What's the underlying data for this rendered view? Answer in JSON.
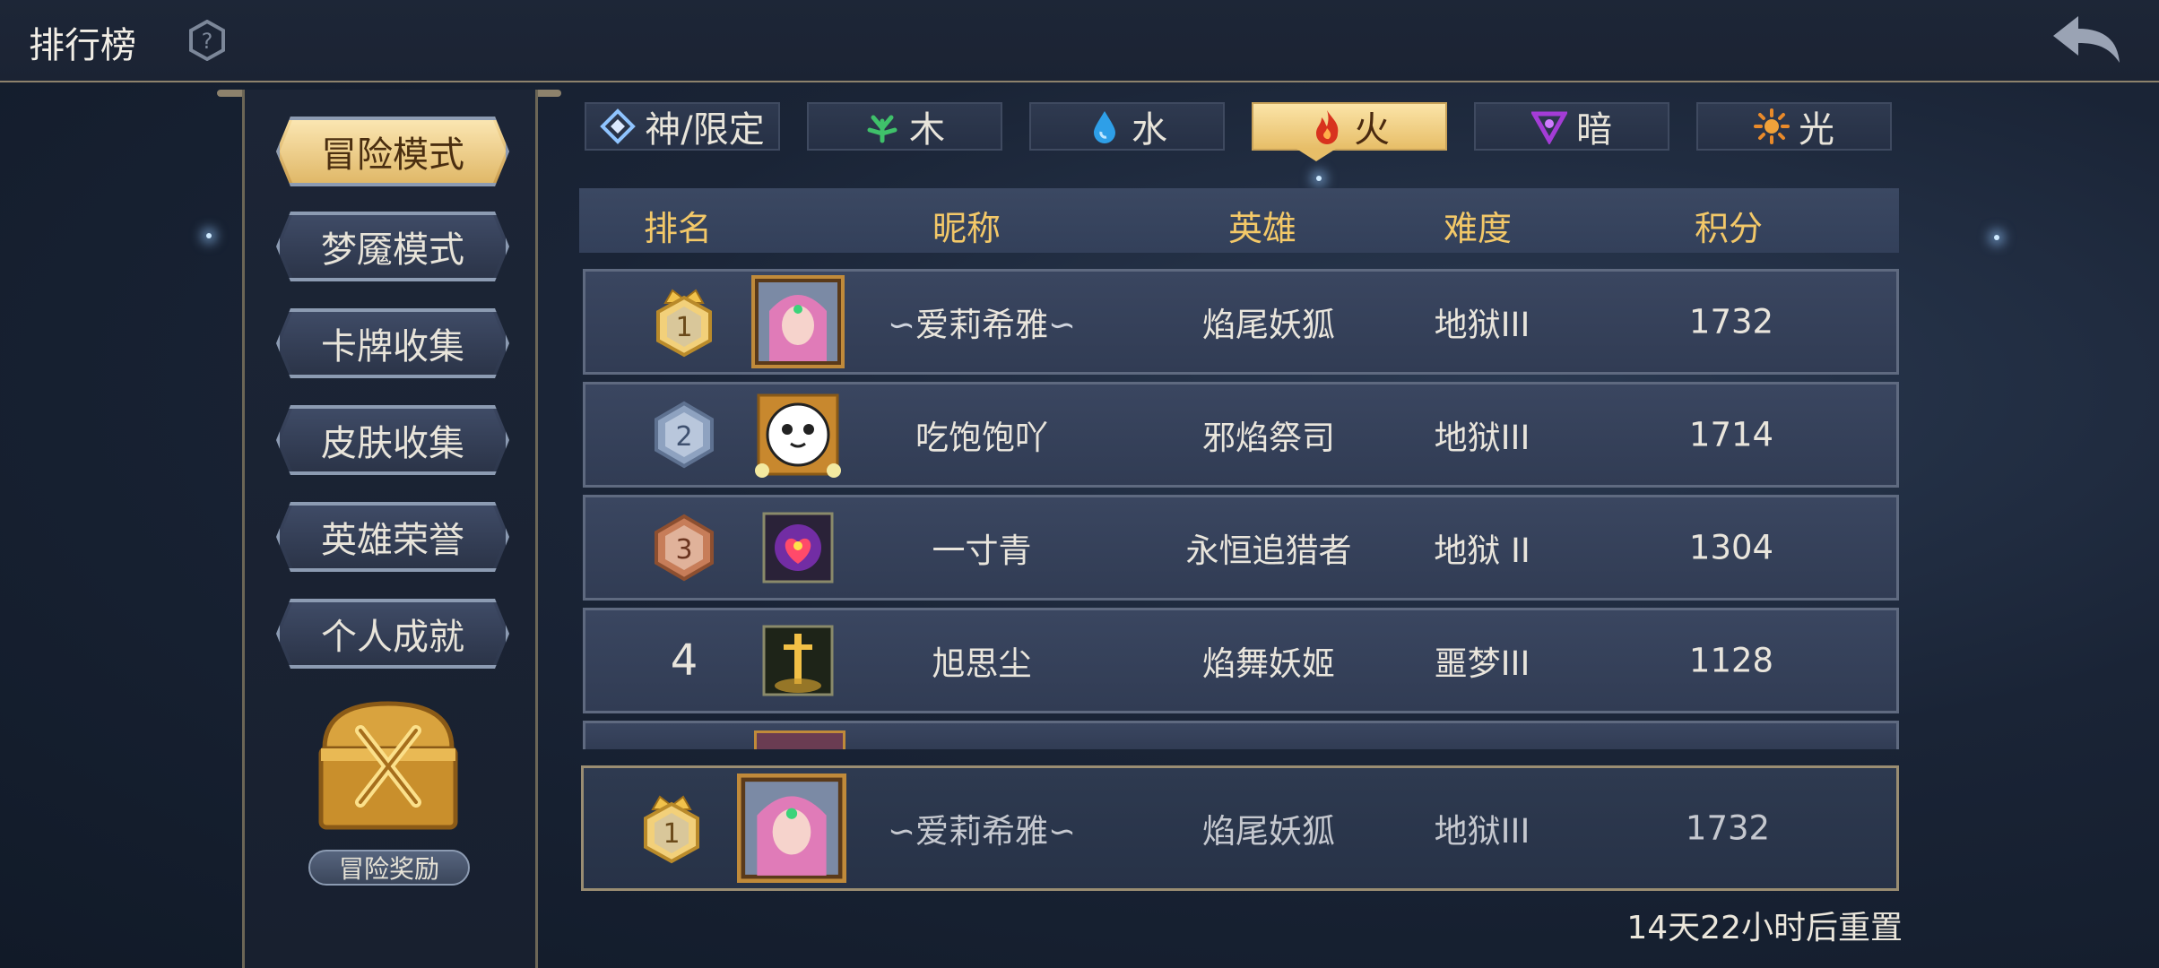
{
  "header": {
    "title": "排行榜"
  },
  "sidebar": {
    "modes": [
      {
        "label": "冒险模式",
        "active": true
      },
      {
        "label": "梦魇模式",
        "active": false
      },
      {
        "label": "卡牌收集",
        "active": false
      },
      {
        "label": "皮肤收集",
        "active": false
      },
      {
        "label": "英雄荣誉",
        "active": false
      },
      {
        "label": "个人成就",
        "active": false
      }
    ],
    "reward_label": "冒险奖励"
  },
  "tabs": [
    {
      "label": "神/限定",
      "icon": "diamond-icon",
      "active": false
    },
    {
      "label": "木",
      "icon": "leaf-icon",
      "active": false
    },
    {
      "label": "水",
      "icon": "water-drop-icon",
      "active": false
    },
    {
      "label": "火",
      "icon": "flame-icon",
      "active": true
    },
    {
      "label": "暗",
      "icon": "dark-sigil-icon",
      "active": false
    },
    {
      "label": "光",
      "icon": "sun-icon",
      "active": false
    }
  ],
  "table": {
    "headers": {
      "rank": "排名",
      "nickname": "昵称",
      "hero": "英雄",
      "difficulty": "难度",
      "score": "积分"
    },
    "rows": [
      {
        "rank": "1",
        "nickname": "爱莉希雅",
        "hero": "焰尾妖狐",
        "difficulty": "地狱III",
        "score": "1732"
      },
      {
        "rank": "2",
        "nickname": "吃饱饱吖",
        "hero": "邪焰祭司",
        "difficulty": "地狱III",
        "score": "1714"
      },
      {
        "rank": "3",
        "nickname": "一寸青",
        "hero": "永恒追猎者",
        "difficulty": "地狱 II",
        "score": "1304"
      },
      {
        "rank": "4",
        "nickname": "旭思尘",
        "hero": "焰舞妖姬",
        "difficulty": "噩梦III",
        "score": "1128"
      }
    ]
  },
  "my_rank": {
    "rank": "1",
    "nickname": "爱莉希雅",
    "hero": "焰尾妖狐",
    "difficulty": "地狱III",
    "score": "1732"
  },
  "reset_text": "14天22小时后重置",
  "colors": {
    "gold": "#f3c868",
    "active_tab": "#e7be68",
    "panel": "#3a4660",
    "background": "#1a2436"
  }
}
